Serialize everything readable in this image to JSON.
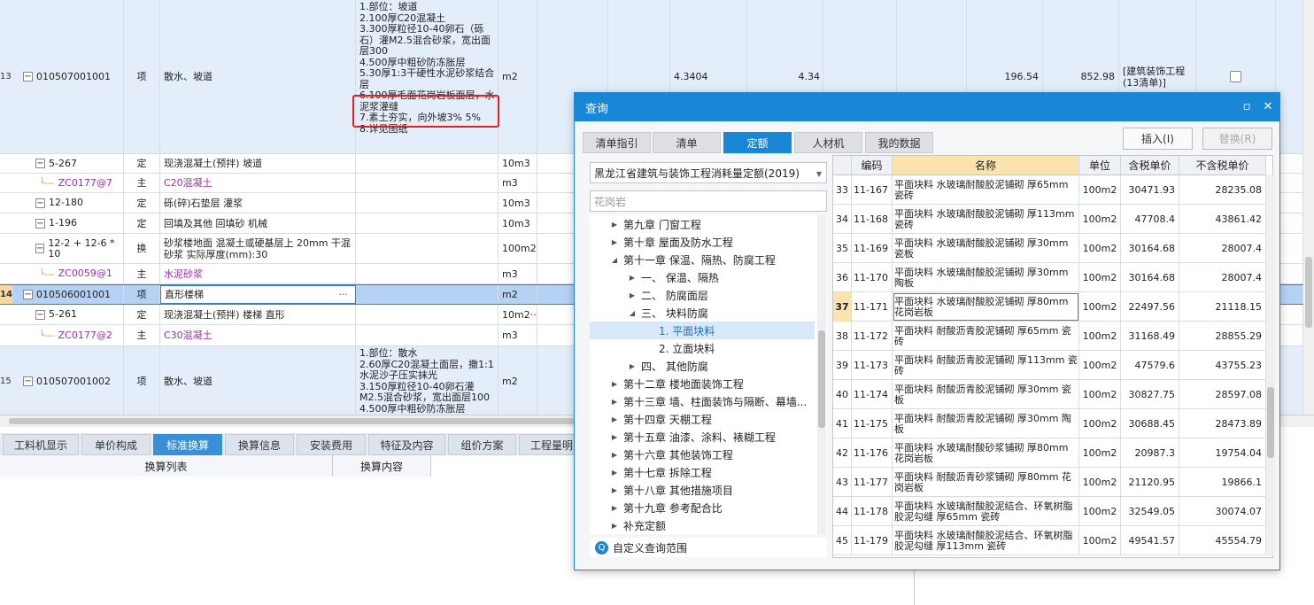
{
  "main_rows": [
    {
      "num": "13",
      "code": "010507001001",
      "type": "项",
      "name": "散水、坡道",
      "desc": [
        "1.部位：坡道",
        "2.100厚C20混凝土",
        "3.300厚粒径10-40卵石（砾石）灌M2.5混合砂浆，宽出面层300",
        "4.500厚中粗砂防冻胀层",
        "5.30厚1:3干硬性水泥砂浆结合层",
        "6.100厚毛面花岗岩板面层，水泥浆灌缝",
        "7.素土夯实，向外坡3% 5%",
        "8.详见图纸"
      ],
      "unit": "m2",
      "qty": "4.3404",
      "qty2": "4.34",
      "price": "196.54",
      "total": "852.98",
      "note": "[建筑装饰工程(13清单)]"
    },
    {
      "code": "5-267",
      "type": "定",
      "name": "现浇混凝土(预拌) 坡道",
      "unit": "10m3"
    },
    {
      "code": "ZC0177@7",
      "type": "主",
      "name": "C20混凝土",
      "unit": "m3"
    },
    {
      "code": "12-180",
      "type": "定",
      "name": "砾(碎)石垫层 灌浆",
      "unit": "10m3"
    },
    {
      "code": "1-196",
      "type": "定",
      "name": "回填及其他 回填砂 机械",
      "unit": "10m3"
    },
    {
      "code": "12-2 + 12-6 * 10",
      "type": "换",
      "name": "砂浆楼地面 混凝土或硬基层上 20mm 干混砂浆  实际厚度(mm):30",
      "unit": "100m2"
    },
    {
      "code": "ZC0059@1",
      "type": "主",
      "name": "水泥砂浆",
      "unit": "m3"
    },
    {
      "num": "14",
      "code": "010506001001",
      "type": "项",
      "name": "直形楼梯",
      "ellipsis": "···",
      "unit": "m2"
    },
    {
      "code": "5-261",
      "type": "定",
      "name": "现浇混凝土(预拌) 楼梯 直形",
      "unit": "10m2···"
    },
    {
      "code": "ZC0177@2",
      "type": "主",
      "name": "C30混凝土",
      "unit": "m3"
    },
    {
      "num": "15",
      "code": "010507001002",
      "type": "项",
      "name": "散水、坡道",
      "desc": [
        "1.部位：散水",
        "2.60厚C20混凝土面层，撒1:1水泥沙子压实抹光",
        "3.150厚粒径10-40卵石灌M2.5混合砂浆，宽出面层100",
        "4.500厚中粗砂防冻胀层"
      ],
      "unit": "m2"
    }
  ],
  "bottom_tabs": [
    "工料机显示",
    "单价构成",
    "标准换算",
    "换算信息",
    "安装费用",
    "特征及内容",
    "组价方案",
    "工程量明"
  ],
  "sub_headers": [
    "换算列表",
    "换算内容"
  ],
  "dialog": {
    "title": "查询",
    "tabs": [
      "清单指引",
      "清单",
      "定额",
      "人材机",
      "我的数据"
    ],
    "insert_btn": "插入(I)",
    "replace_btn": "替换(R)",
    "library": "黑龙江省建筑与装饰工程消耗量定额(2019)",
    "search": "花岗岩",
    "tree": [
      {
        "label": "第九章 门窗工程",
        "lvl": 0,
        "arrow": "▶"
      },
      {
        "label": "第十章 屋面及防水工程",
        "lvl": 0,
        "arrow": "▶"
      },
      {
        "label": "第十一章 保温、隔热、防腐工程",
        "lvl": 0,
        "arrow": "◢"
      },
      {
        "label": "一、 保温、隔热",
        "lvl": 1,
        "arrow": "▶"
      },
      {
        "label": "二、 防腐面层",
        "lvl": 1,
        "arrow": "▶"
      },
      {
        "label": "三、 块料防腐",
        "lvl": 1,
        "arrow": "◢"
      },
      {
        "label": "1. 平面块料",
        "lvl": 2,
        "arrow": "",
        "sel": true
      },
      {
        "label": "2. 立面块料",
        "lvl": 2,
        "arrow": ""
      },
      {
        "label": "四、 其他防腐",
        "lvl": 1,
        "arrow": "▶"
      },
      {
        "label": "第十二章 楼地面装饰工程",
        "lvl": 0,
        "arrow": "▶"
      },
      {
        "label": "第十三章 墙、柱面装饰与隔断、幕墙...",
        "lvl": 0,
        "arrow": "▶"
      },
      {
        "label": "第十四章 天棚工程",
        "lvl": 0,
        "arrow": "▶"
      },
      {
        "label": "第十五章 油漆、涂料、裱糊工程",
        "lvl": 0,
        "arrow": "▶"
      },
      {
        "label": "第十六章 其他装饰工程",
        "lvl": 0,
        "arrow": "▶"
      },
      {
        "label": "第十七章 拆除工程",
        "lvl": 0,
        "arrow": "▶"
      },
      {
        "label": "第十八章 其他措施项目",
        "lvl": 0,
        "arrow": "▶"
      },
      {
        "label": "第十九章 参考配合比",
        "lvl": 0,
        "arrow": "▶"
      },
      {
        "label": "补充定额",
        "lvl": 0,
        "arrow": "▶"
      }
    ],
    "custom_range": "自定义查询范围",
    "grid_headers": [
      "",
      "编码",
      "名称",
      "单位",
      "含税单价",
      "不含税单价"
    ],
    "grid_rows": [
      {
        "idx": "33",
        "code": "11-167",
        "name": "平面块料 水玻璃耐酸胶泥铺砌 厚65mm 瓷砖",
        "unit": "100m2",
        "tax": "30471.93",
        "notax": "28235.08"
      },
      {
        "idx": "34",
        "code": "11-168",
        "name": "平面块料 水玻璃耐酸胶泥铺砌 厚113mm 瓷砖",
        "unit": "100m2",
        "tax": "47708.4",
        "notax": "43861.42"
      },
      {
        "idx": "35",
        "code": "11-169",
        "name": "平面块料 水玻璃耐酸胶泥铺砌 厚30mm 瓷板",
        "unit": "100m2",
        "tax": "30164.68",
        "notax": "28007.4"
      },
      {
        "idx": "36",
        "code": "11-170",
        "name": "平面块料 水玻璃耐酸胶泥铺砌 厚30mm 陶板",
        "unit": "100m2",
        "tax": "30164.68",
        "notax": "28007.4"
      },
      {
        "idx": "37",
        "code": "11-171",
        "name": "平面块料 水玻璃耐酸胶泥铺砌 厚80mm 花岗岩板",
        "unit": "100m2",
        "tax": "22497.56",
        "notax": "21118.15",
        "cur": true
      },
      {
        "idx": "38",
        "code": "11-172",
        "name": "平面块料 耐酸沥青胶泥铺砌 厚65mm 瓷砖",
        "unit": "100m2",
        "tax": "31168.49",
        "notax": "28855.29"
      },
      {
        "idx": "39",
        "code": "11-173",
        "name": "平面块料 耐酸沥青胶泥铺砌 厚113mm 瓷砖",
        "unit": "100m2",
        "tax": "47579.6",
        "notax": "43755.23"
      },
      {
        "idx": "40",
        "code": "11-174",
        "name": "平面块料 耐酸沥青胶泥铺砌 厚30mm 瓷板",
        "unit": "100m2",
        "tax": "30827.75",
        "notax": "28597.08"
      },
      {
        "idx": "41",
        "code": "11-175",
        "name": "平面块料 耐酸沥青胶泥铺砌 厚30mm 陶板",
        "unit": "100m2",
        "tax": "30688.45",
        "notax": "28473.89"
      },
      {
        "idx": "42",
        "code": "11-176",
        "name": "平面块料 水玻璃耐酸砂浆铺砌 厚80mm 花岗岩板",
        "unit": "100m2",
        "tax": "20987.3",
        "notax": "19754.04"
      },
      {
        "idx": "43",
        "code": "11-177",
        "name": "平面块料 耐酸沥青砂浆铺砌 厚80mm 花岗岩板",
        "unit": "100m2",
        "tax": "21120.95",
        "notax": "19866.1"
      },
      {
        "idx": "44",
        "code": "11-178",
        "name": "平面块料 水玻璃耐酸胶泥结合、环氧树脂胶泥勾缝 厚65mm 瓷砖",
        "unit": "100m2",
        "tax": "32549.05",
        "notax": "30074.07"
      },
      {
        "idx": "45",
        "code": "11-179",
        "name": "平面块料 水玻璃耐酸胶泥结合、环氧树脂胶泥勾缝 厚113mm 瓷砖",
        "unit": "100m2",
        "tax": "49541.57",
        "notax": "45554.79"
      }
    ]
  },
  "colors": {
    "accent": "#1a86d6",
    "highlight": "#e02020",
    "purple": "#9b2fae"
  }
}
